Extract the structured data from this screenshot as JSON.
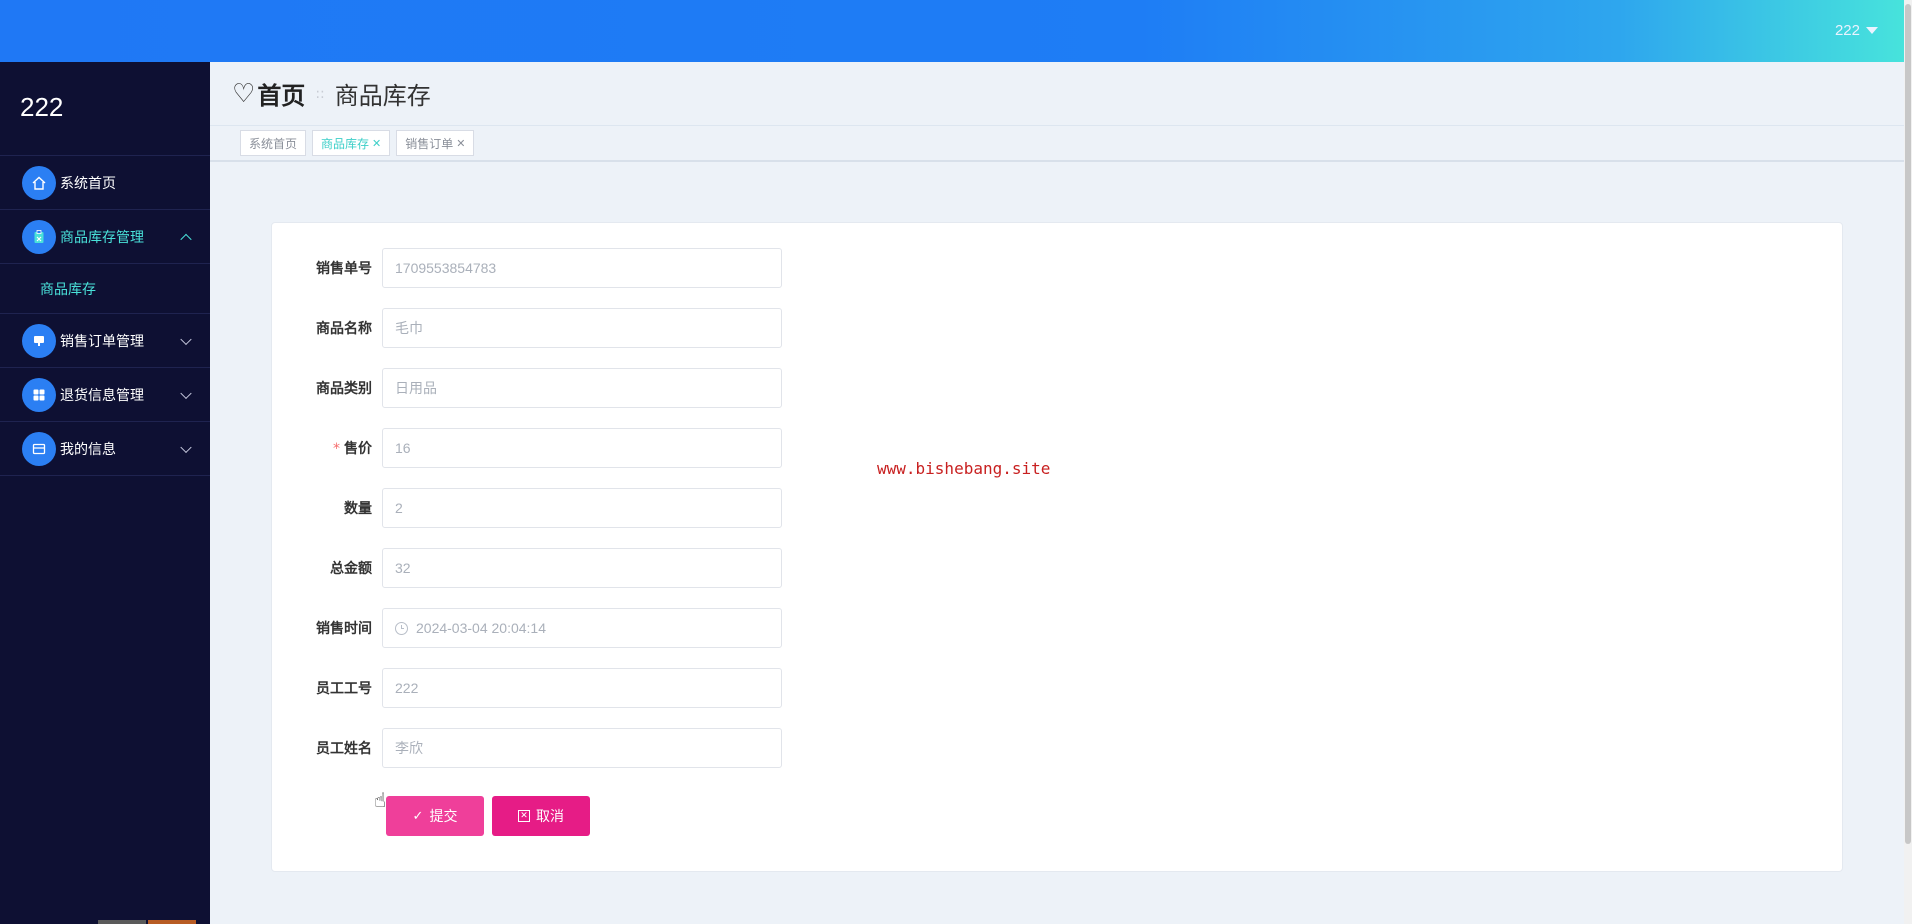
{
  "topbar": {
    "username": "222"
  },
  "sidebar": {
    "brand": "222",
    "items": [
      {
        "label": "系统首页",
        "icon": "home-icon"
      },
      {
        "label": "商品库存管理",
        "icon": "clipboard-icon",
        "expanded": true,
        "children": [
          {
            "label": "商品库存"
          }
        ]
      },
      {
        "label": "销售订单管理",
        "icon": "monitor-icon"
      },
      {
        "label": "退货信息管理",
        "icon": "grid-icon"
      },
      {
        "label": "我的信息",
        "icon": "wallet-icon"
      }
    ]
  },
  "breadcrumb": {
    "home": "首页",
    "separator": "::",
    "current": "商品库存"
  },
  "tags": [
    {
      "label": "系统首页",
      "closable": false,
      "active": false
    },
    {
      "label": "商品库存",
      "closable": true,
      "active": true
    },
    {
      "label": "销售订单",
      "closable": true,
      "active": false
    }
  ],
  "form": {
    "fields": [
      {
        "label": "销售单号",
        "value": "1709553854783",
        "required": false
      },
      {
        "label": "商品名称",
        "value": "毛巾",
        "required": false
      },
      {
        "label": "商品类别",
        "value": "日用品",
        "required": false
      },
      {
        "label": "售价",
        "value": "16",
        "required": true
      },
      {
        "label": "数量",
        "value": "2",
        "required": false
      },
      {
        "label": "总金额",
        "value": "32",
        "required": false
      },
      {
        "label": "销售时间",
        "value": "2024-03-04 20:04:14",
        "required": false
      },
      {
        "label": "员工工号",
        "value": "222",
        "required": false
      },
      {
        "label": "员工姓名",
        "value": "李欣",
        "required": false
      }
    ],
    "submit_label": "提交",
    "cancel_label": "取消"
  },
  "watermark": "www.bishebang.site",
  "colors": {
    "accent": "#49e1d9",
    "primary": "#1f78f5",
    "submit": "#ef3f9a",
    "cancel": "#e61c86",
    "sidebar": "#0e1033"
  }
}
